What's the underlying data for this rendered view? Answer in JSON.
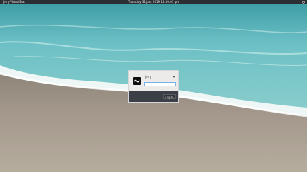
{
  "topbar": {
    "hostname": "jerry-VirtualBox",
    "clock": "Thursday 31 Jan, 2019 15:00:05 pm",
    "power_icon": "power-icon"
  },
  "login": {
    "username": "jerry",
    "username_chevron": "chevron-down-icon",
    "password_value": "",
    "button_label": "Log In",
    "avatar_icon": "tilde-logo-icon"
  },
  "colors": {
    "topbar": "#2b2f33",
    "dialog": "#ecebea",
    "dialog_footer": "#3c3f45"
  }
}
